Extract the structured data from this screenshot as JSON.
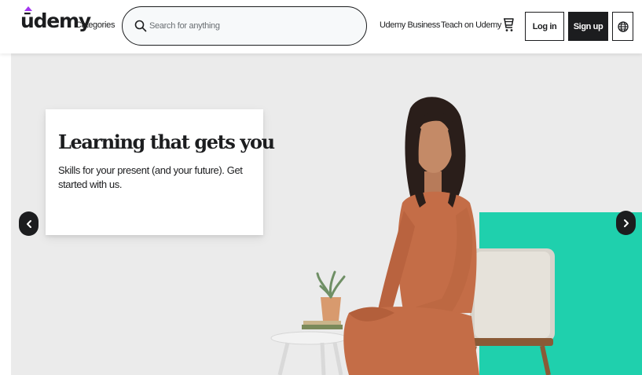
{
  "header": {
    "logo": "ūdemy",
    "categories_label": "Categories",
    "search": {
      "placeholder": "Search for anything",
      "value": ""
    },
    "nav": {
      "business": "Udemy Business",
      "teach": "Teach on Udemy"
    },
    "login_label": "Log in",
    "signup_label": "Sign up",
    "icons": {
      "search": "search-icon",
      "cart": "cart-icon",
      "language": "globe-icon"
    }
  },
  "hero": {
    "title": "Learning that gets you",
    "subtitle": "Skills for your present (and your future). Get started with us.",
    "prev_icon": "chevron-left-icon",
    "next_icon": "chevron-right-icon",
    "colors": {
      "background": "#ebebeb",
      "accent_block": "#1fd0ad",
      "dress": "#c46d47"
    }
  },
  "colors": {
    "brand": "#a435f0",
    "text": "#1c1d1f",
    "button_dark": "#1c1d1f"
  }
}
